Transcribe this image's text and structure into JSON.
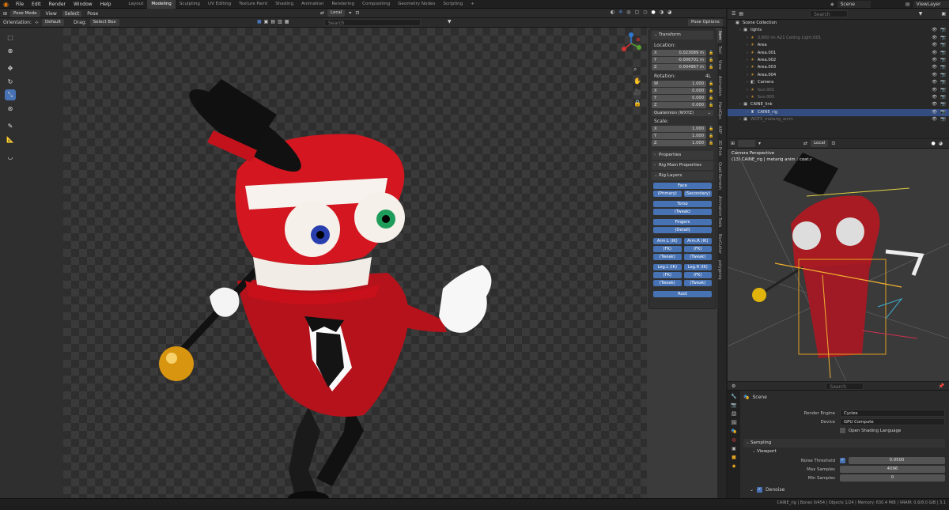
{
  "menu": [
    "File",
    "Edit",
    "Render",
    "Window",
    "Help"
  ],
  "workspaces": [
    "Layout",
    "Modeling",
    "Sculpting",
    "UV Editing",
    "Texture Paint",
    "Shading",
    "Animation",
    "Rendering",
    "Compositing",
    "Geometry Nodes",
    "Scripting",
    "+"
  ],
  "scene_label": "Scene",
  "viewlayer_label": "ViewLayer",
  "header": {
    "mode": "Pose Mode",
    "view": "View",
    "select": "Select",
    "pose": "Pose",
    "orientation_label": "Orientation:",
    "orientation_value": "Default",
    "drag_label": "Drag:",
    "drag_value": "Select Box",
    "pivot": "Local",
    "search_placeholder": "Search",
    "pose_options": "Pose Options"
  },
  "npanel": {
    "transform_title": "Transform",
    "location_label": "Location:",
    "location": [
      {
        "axis": "X",
        "value": "0.023089 m"
      },
      {
        "axis": "Y",
        "value": "-0.006701 m"
      },
      {
        "axis": "Z",
        "value": "0.004967 m"
      }
    ],
    "rotation_label": "Rotation:",
    "rotation_extra": "4L",
    "rotation": [
      {
        "axis": "W",
        "value": "1.000"
      },
      {
        "axis": "X",
        "value": "0.000"
      },
      {
        "axis": "Y",
        "value": "0.000"
      },
      {
        "axis": "Z",
        "value": "0.000"
      }
    ],
    "rotation_mode": "Quaternion (WXYZ)",
    "scale_label": "Scale:",
    "scale": [
      {
        "axis": "X",
        "value": "1.000"
      },
      {
        "axis": "Y",
        "value": "1.000"
      },
      {
        "axis": "Z",
        "value": "1.000"
      }
    ],
    "properties": "Properties",
    "rig_main": "Rig Main Properties",
    "rig_layers": "Rig Layers",
    "face": "Face",
    "primary": "(Primary)",
    "secondary": "(Secondary)",
    "torso": "Torso",
    "tweak": "(Tweak)",
    "fingers": "Fingers",
    "detail": "(Detail)",
    "arm_l_ik": "Arm.L (IK)",
    "arm_r_ik": "Arm.R (IK)",
    "fk": "(FK)",
    "leg_l_ik": "Leg.L (IK)",
    "leg_r_ik": "Leg.R (IK)",
    "root": "Root"
  },
  "side_tabs": [
    "Item",
    "Tool",
    "View",
    "Animation",
    "HardOps",
    "ARP",
    "3D Print",
    "Quad Remesh",
    "Animation Tools",
    "BoxCutter",
    "polygoniq"
  ],
  "outliner": {
    "search_placeholder": "Search",
    "collection": "Scene Collection",
    "rows": [
      {
        "name": "lights",
        "indent": 1,
        "icon": "▣",
        "dim": false,
        "sel": false
      },
      {
        "name": "3,800 lm A21 Ceiling Light.001",
        "indent": 2,
        "icon": "☀",
        "dim": true,
        "sel": false
      },
      {
        "name": "Area",
        "indent": 2,
        "icon": "☀",
        "dim": false,
        "sel": false
      },
      {
        "name": "Area.001",
        "indent": 2,
        "icon": "☀",
        "dim": false,
        "sel": false
      },
      {
        "name": "Area.002",
        "indent": 2,
        "icon": "☀",
        "dim": false,
        "sel": false
      },
      {
        "name": "Area.003",
        "indent": 2,
        "icon": "☀",
        "dim": false,
        "sel": false
      },
      {
        "name": "Area.004",
        "indent": 2,
        "icon": "☀",
        "dim": false,
        "sel": false
      },
      {
        "name": "Camera",
        "indent": 2,
        "icon": "◧",
        "dim": false,
        "sel": false
      },
      {
        "name": "Sun.001",
        "indent": 2,
        "icon": "☀",
        "dim": true,
        "sel": false
      },
      {
        "name": "Sun.005",
        "indent": 2,
        "icon": "☀",
        "dim": true,
        "sel": false
      },
      {
        "name": "CAINE_link",
        "indent": 1,
        "icon": "▣",
        "dim": false,
        "sel": false
      },
      {
        "name": "CAINE_rig",
        "indent": 2,
        "icon": "♜",
        "dim": false,
        "sel": true
      },
      {
        "name": "WGTS_metarig_anim",
        "indent": 1,
        "icon": "▣",
        "dim": true,
        "sel": false
      }
    ]
  },
  "camera_view": {
    "title": "Camera Perspective",
    "subtitle": "(13) CAINE_rig | metarig anim : coat.r",
    "pivot": "Local"
  },
  "properties": {
    "scene": "Scene",
    "search_placeholder": "Search",
    "render_engine_label": "Render Engine",
    "render_engine": "Cycles",
    "device_label": "Device",
    "device": "GPU Compute",
    "osl": "Open Shading Language",
    "sampling": "Sampling",
    "viewport": "Viewport",
    "noise_label": "Noise Threshold",
    "noise_value": "0.0500",
    "max_label": "Max Samples",
    "max_value": "4096",
    "min_label": "Min Samples",
    "min_value": "0",
    "denoise": "Denoise"
  },
  "status": "CAINE_rig | Bones 0/454 | Objects 1/24 | Memory: 630.4 MiB | VRAM: 0.6/8.0 GiB | 3.1"
}
